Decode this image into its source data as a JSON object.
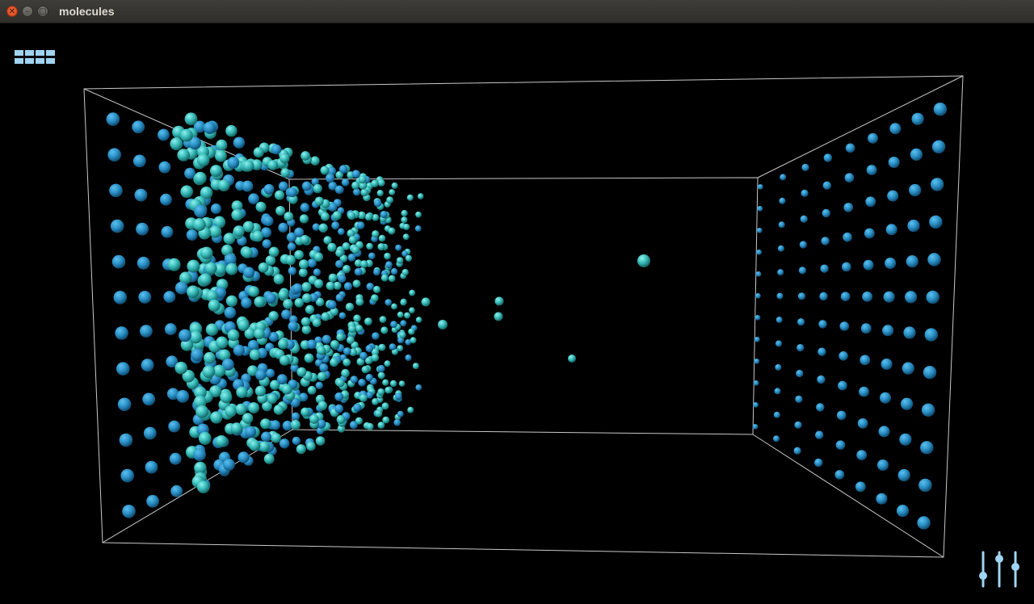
{
  "window": {
    "title": "molecules"
  },
  "controls": {
    "close_glyph": "✕",
    "minimize_glyph": "–",
    "maximize_glyph": "□",
    "menu_icon": "grid-menu-icon",
    "settings_icon": "sliders-icon"
  },
  "colors": {
    "background": "#000000",
    "box_edges": "#c8c8c8",
    "molecule_blue": "#2a8fc4",
    "molecule_teal": "#35b8b6",
    "icon_blue": "#9fd4f2"
  }
}
